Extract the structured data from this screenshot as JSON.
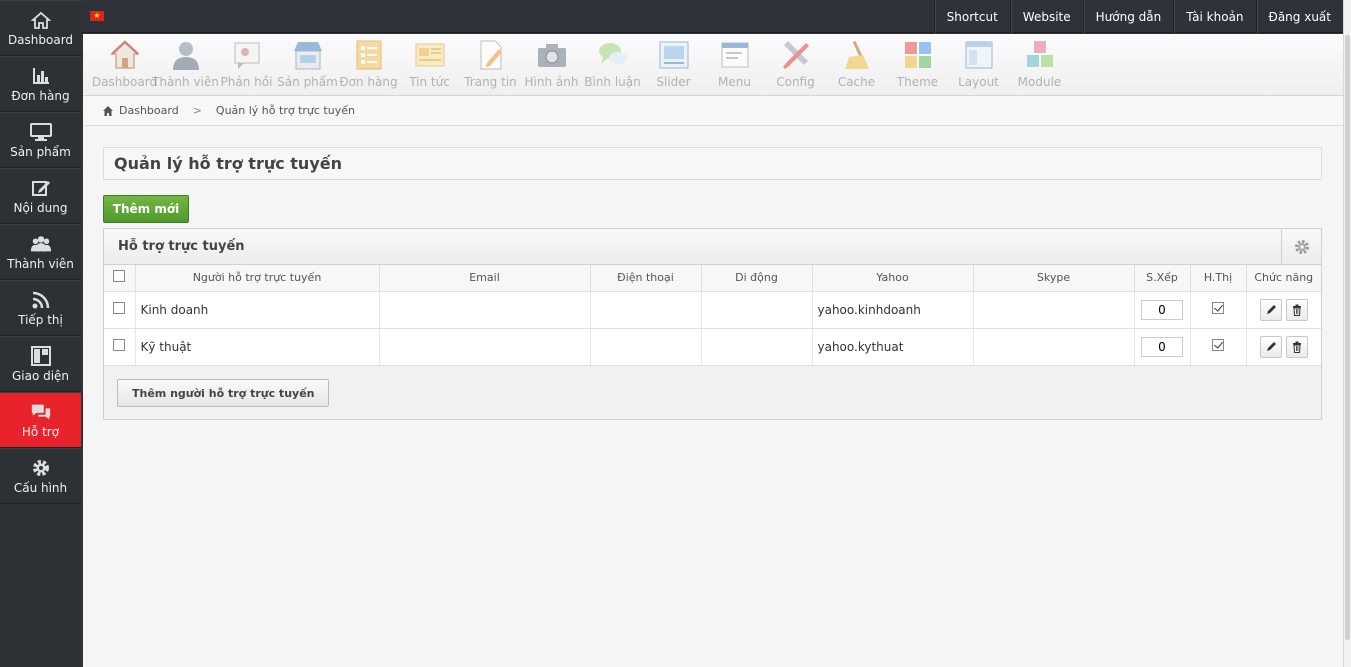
{
  "sidebar": {
    "items": [
      {
        "label": "Dashboard",
        "icon": "home-icon"
      },
      {
        "label": "Đơn hàng",
        "icon": "bar-chart-icon"
      },
      {
        "label": "Sản phẩm",
        "icon": "monitor-icon"
      },
      {
        "label": "Nội dung",
        "icon": "edit-icon"
      },
      {
        "label": "Thành viên",
        "icon": "users-icon"
      },
      {
        "label": "Tiếp thị",
        "icon": "rss-icon"
      },
      {
        "label": "Giao diện",
        "icon": "layout-icon"
      },
      {
        "label": "Hỗ trợ",
        "icon": "chat-icon",
        "active": true
      },
      {
        "label": "Cấu hình",
        "icon": "gear-icon"
      }
    ],
    "active_color": "#e8232b"
  },
  "topbar": {
    "links": [
      "Shortcut",
      "Website",
      "Hướng dẫn",
      "Tài khoản",
      "Đăng xuất"
    ]
  },
  "toolbar": {
    "items": [
      {
        "label": "Dashboard",
        "icon": "house-icon"
      },
      {
        "label": "Thành viên",
        "icon": "user-icon"
      },
      {
        "label": "Phản hồi",
        "icon": "feedback-icon"
      },
      {
        "label": "Sản phẩm",
        "icon": "store-icon"
      },
      {
        "label": "Đơn hàng",
        "icon": "checklist-icon"
      },
      {
        "label": "Tin tức",
        "icon": "news-icon"
      },
      {
        "label": "Trang tin",
        "icon": "page-icon"
      },
      {
        "label": "Hình ảnh",
        "icon": "camera-icon"
      },
      {
        "label": "Bình luận",
        "icon": "comment-icon"
      },
      {
        "label": "Slider",
        "icon": "slider-icon"
      },
      {
        "label": "Menu",
        "icon": "menu-icon"
      },
      {
        "label": "Config",
        "icon": "tools-icon"
      },
      {
        "label": "Cache",
        "icon": "broom-icon"
      },
      {
        "label": "Theme",
        "icon": "theme-icon"
      },
      {
        "label": "Layout",
        "icon": "layout-icon"
      },
      {
        "label": "Module",
        "icon": "cubes-icon"
      }
    ]
  },
  "breadcrumb": {
    "home": "Dashboard",
    "current": "Quản lý hỗ trợ trực tuyến"
  },
  "page": {
    "title": "Quản lý hỗ trợ trực tuyến",
    "add_button": "Thêm mới"
  },
  "panel": {
    "title": "Hỗ trợ trực tuyến",
    "columns": [
      "Người hỗ trợ trực tuyến",
      "Email",
      "Điện thoại",
      "Di động",
      "Yahoo",
      "Skype",
      "S.Xếp",
      "H.Thị",
      "Chức năng"
    ],
    "rows": [
      {
        "name": "Kinh doanh",
        "email": "",
        "phone": "",
        "mobile": "",
        "yahoo": "yahoo.kinhdoanh",
        "skype": "",
        "order": "0",
        "visible": true
      },
      {
        "name": "Kỹ thuật",
        "email": "",
        "phone": "",
        "mobile": "",
        "yahoo": "yahoo.kythuat",
        "skype": "",
        "order": "0",
        "visible": true
      }
    ],
    "add_row_button": "Thêm người hỗ trợ trực tuyến"
  }
}
